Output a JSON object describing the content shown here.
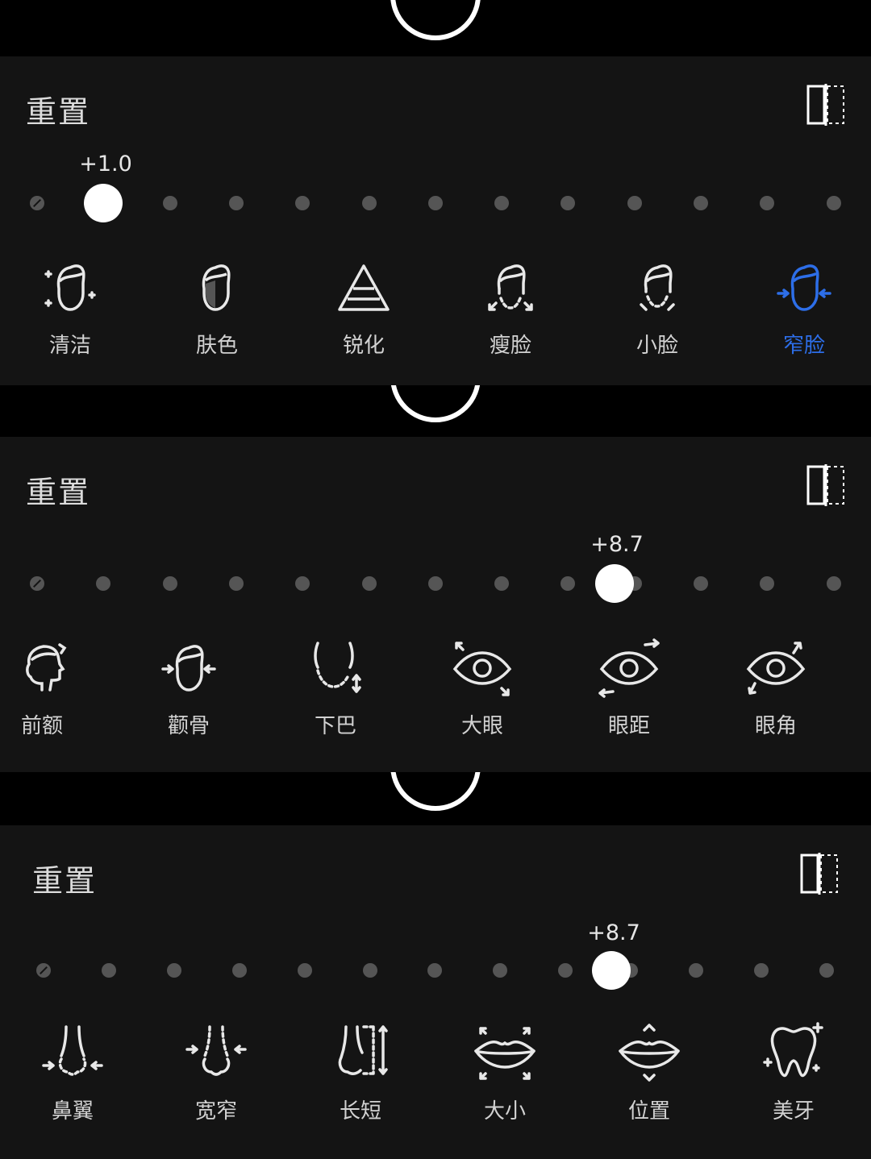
{
  "colors": {
    "background": "#000000",
    "panel": "#141414",
    "active": "#2D6EE8",
    "dot": "#555555",
    "knob": "#FFFFFF"
  },
  "panels": [
    {
      "reset_label": "重置",
      "compare_icon": "split-compare-icon",
      "slider": {
        "value_label": "+1.0",
        "position_index": 1,
        "dot_count": 13
      },
      "tools": [
        {
          "label": "清洁",
          "icon": "face-clean-icon",
          "active": false
        },
        {
          "label": "肤色",
          "icon": "face-skintone-icon",
          "active": false
        },
        {
          "label": "锐化",
          "icon": "sharpen-triangle-icon",
          "active": false
        },
        {
          "label": "瘦脸",
          "icon": "face-slim-icon",
          "active": false
        },
        {
          "label": "小脸",
          "icon": "face-small-icon",
          "active": false
        },
        {
          "label": "窄脸",
          "icon": "face-narrow-icon",
          "active": true
        }
      ]
    },
    {
      "reset_label": "重置",
      "compare_icon": "split-compare-icon",
      "slider": {
        "value_label": "+8.7",
        "position_index": 8.7,
        "dot_count": 13
      },
      "tools": [
        {
          "label": "前额",
          "icon": "forehead-profile-icon",
          "active": false
        },
        {
          "label": "颧骨",
          "icon": "cheekbone-icon",
          "active": false
        },
        {
          "label": "下巴",
          "icon": "chin-icon",
          "active": false
        },
        {
          "label": "大眼",
          "icon": "eye-enlarge-icon",
          "active": false
        },
        {
          "label": "眼距",
          "icon": "eye-distance-icon",
          "active": false
        },
        {
          "label": "眼角",
          "icon": "eye-angle-icon",
          "active": false
        }
      ]
    },
    {
      "reset_label": "重置",
      "compare_icon": "split-compare-icon",
      "slider": {
        "value_label": "+8.7",
        "position_index": 8.7,
        "dot_count": 13
      },
      "tools": [
        {
          "label": "鼻翼",
          "icon": "nose-wing-icon",
          "active": false
        },
        {
          "label": "宽窄",
          "icon": "nose-width-icon",
          "active": false
        },
        {
          "label": "长短",
          "icon": "nose-length-icon",
          "active": false
        },
        {
          "label": "大小",
          "icon": "lips-size-icon",
          "active": false
        },
        {
          "label": "位置",
          "icon": "lips-position-icon",
          "active": false
        },
        {
          "label": "美牙",
          "icon": "tooth-whiten-icon",
          "active": false
        }
      ]
    }
  ]
}
